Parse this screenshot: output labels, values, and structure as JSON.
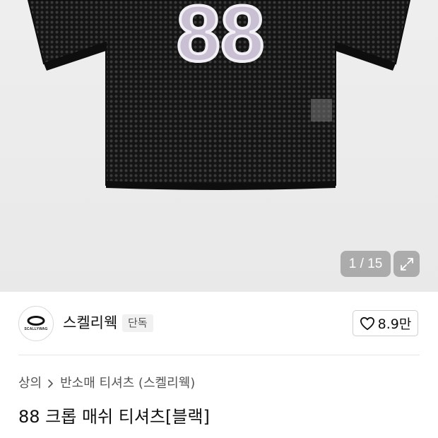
{
  "gallery": {
    "counter": "1 / 15",
    "jersey_number": "88"
  },
  "brand": {
    "name": "스켈리웩",
    "badge": "단독",
    "logo_text": "SCALLYWAG",
    "like_count": "8.9만"
  },
  "breadcrumb": {
    "category": "상의",
    "subcategory": "반소매 티셔츠 (스켈리웩)"
  },
  "product": {
    "title": "88 크롭 매쉬 티셔츠[블랙]"
  },
  "colors": {
    "jersey": "#1a1a1a",
    "number_fill": "#c9c0d3",
    "number_outline": "#f2f0f4",
    "accent_text": "#111111"
  }
}
